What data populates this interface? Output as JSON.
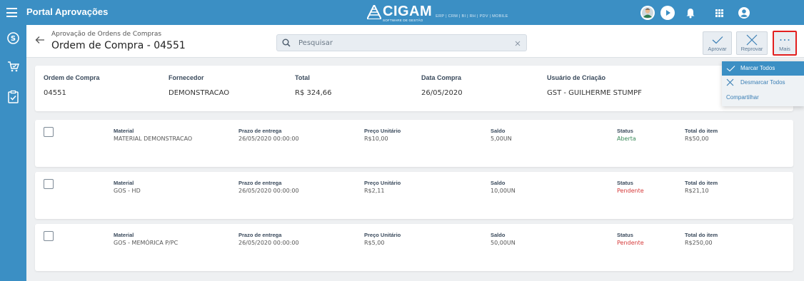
{
  "header": {
    "app_title": "Portal Aprovações",
    "logo_word": "CIGAM",
    "logo_subtitle": "SOFTWARE DE GESTÃO",
    "logo_modules": "ERP | CRM | BI | RH | PDV | MOBILE",
    "icons": [
      "menu-icon",
      "avatar-icon",
      "play-icon",
      "bell-icon",
      "apps-grid-icon",
      "account-icon"
    ]
  },
  "sidebar": {
    "icons": [
      "coin-icon",
      "cart-check-icon",
      "clipboard-check-icon"
    ]
  },
  "subheader": {
    "breadcrumb": "Aprovação de Ordens de Compras",
    "title": "Ordem de Compra - 04551",
    "search_placeholder": "Pesquisar",
    "actions": {
      "approve": "Aprovar",
      "reject": "Reprovar",
      "more": "Mais"
    }
  },
  "order": {
    "labels": {
      "order": "Ordem de Compra",
      "supplier": "Fornecedor",
      "total": "Total",
      "date": "Data Compra",
      "user": "Usuário de Criação"
    },
    "values": {
      "order": "04551",
      "supplier": "DEMONSTRACAO",
      "total": "R$ 324,66",
      "date": "26/05/2020",
      "user": "GST - GUILHERME STUMPF"
    }
  },
  "item_labels": {
    "material": "Material",
    "deadline": "Prazo de entrega",
    "unit_price": "Preço Unitário",
    "balance": "Saldo",
    "status": "Status",
    "item_total": "Total do item"
  },
  "items": [
    {
      "material": "MATERIAL DEMONSTRACAO",
      "deadline": "26/05/2020 00:00:00",
      "unit_price": "R$10,00",
      "balance": "5,00UN",
      "status": "Aberta",
      "item_total": "R$50,00"
    },
    {
      "material": "GOS - HD",
      "deadline": "26/05/2020 00:00:00",
      "unit_price": "R$2,11",
      "balance": "10,00UN",
      "status": "Pendente",
      "item_total": "R$21,10"
    },
    {
      "material": "GOS - MEMÓRICA P/PC",
      "deadline": "26/05/2020 00:00:00",
      "unit_price": "R$5,00",
      "balance": "50,00UN",
      "status": "Pendente",
      "item_total": "R$250,00"
    }
  ],
  "dropdown": {
    "select_all": "Marcar Todos",
    "deselect_all": "Desmarcar Todos",
    "share": "Compartilhar"
  },
  "colors": {
    "primary": "#3b8fc4",
    "status_open": "#3a8a5a",
    "status_pending": "#d63a3a",
    "highlight_border": "#e21f1f"
  }
}
